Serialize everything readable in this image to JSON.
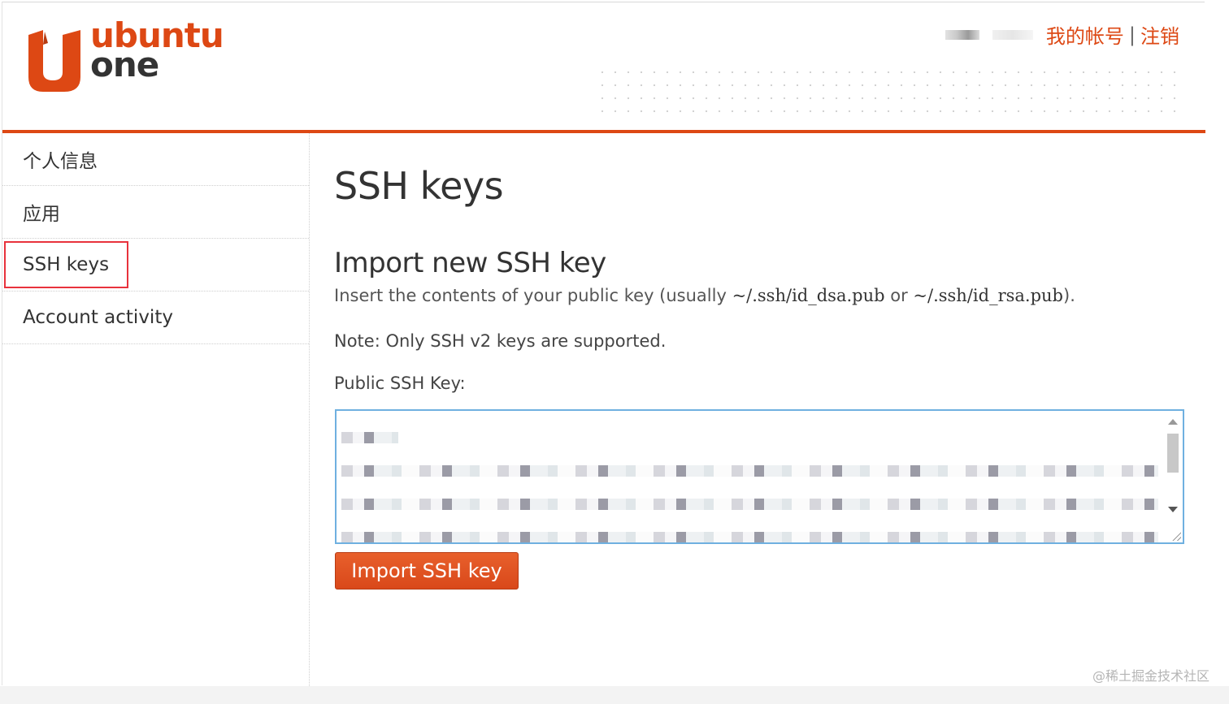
{
  "header": {
    "logo_line1": "ubuntu",
    "logo_line2": "one",
    "my_account": "我的帐号",
    "separator": "|",
    "logout": "注销",
    "accent_color": "#dd4814"
  },
  "sidebar": {
    "items": [
      {
        "label": "个人信息"
      },
      {
        "label": "应用"
      },
      {
        "label": "SSH keys"
      },
      {
        "label": "Account activity"
      }
    ],
    "active_index": 2
  },
  "main": {
    "title": "SSH keys",
    "section_title": "Import new SSH key",
    "instruction_pre": "Insert the contents of your public key (usually ",
    "path_dsa": "~/.ssh/id_dsa.pub",
    "instruction_or": " or ",
    "path_rsa": "~/.ssh/id_rsa.pub",
    "instruction_post": ").",
    "note": "Note: Only SSH v2 keys are supported.",
    "field_label": "Public SSH Key:",
    "button_label": "Import SSH key"
  },
  "watermark": "@稀土掘金技术社区"
}
